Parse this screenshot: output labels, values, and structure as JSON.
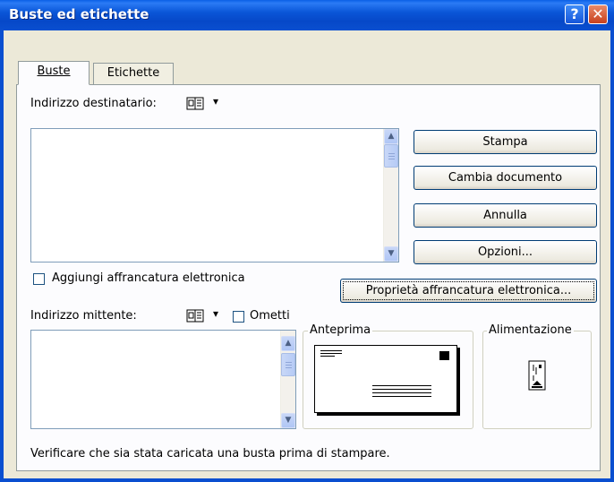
{
  "window": {
    "title": "Buste ed etichette",
    "help_glyph": "?",
    "close_glyph": "✕"
  },
  "tabs": [
    {
      "label": "Buste",
      "mnemonic_index": 0,
      "active": true
    },
    {
      "label": "Etichette",
      "mnemonic_index": 0,
      "active": false
    }
  ],
  "recipient": {
    "label": "Indirizzo destinatario:",
    "value": ""
  },
  "address_book_icon": "address-book-icon",
  "dropdown_glyph": "▾",
  "buttons": {
    "print": "Stampa",
    "new_document": "Cambia documento",
    "cancel": "Annulla",
    "options": "Opzioni...",
    "epostage_properties": "Proprietà affrancatura elettronica..."
  },
  "epostage_checkbox": {
    "label": "Aggiungi affrancatura elettronica",
    "checked": false
  },
  "sender": {
    "label": "Indirizzo mittente:",
    "value": ""
  },
  "omit_checkbox": {
    "label": "Ometti",
    "checked": false
  },
  "preview": {
    "title": "Anteprima"
  },
  "feed": {
    "title": "Alimentazione"
  },
  "status_text": "Verificare che sia stata caricata una busta prima di stampare.",
  "colors": {
    "title_bar": "#0a56d8",
    "dialog_bg": "#ece9d8",
    "panel_bg": "#fcfcfe",
    "button_border": "#003c74"
  }
}
